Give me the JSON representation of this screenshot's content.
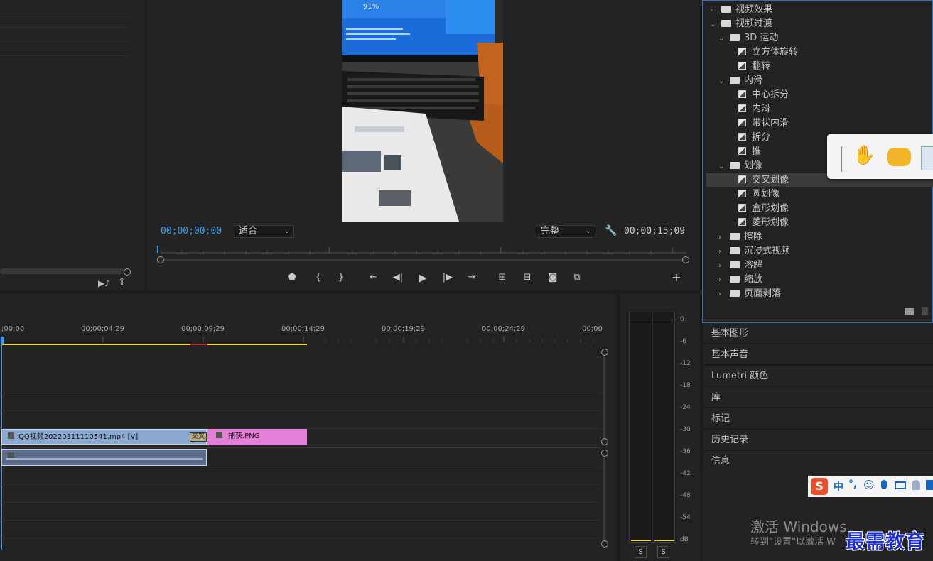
{
  "program_monitor": {
    "timecode_current": "00;00;00;00",
    "timecode_duration": "00;00;15;09",
    "fit_dropdown": "适合",
    "quality_dropdown": "完整",
    "video_progress_text": "91%"
  },
  "effects_tree": [
    {
      "label": "视频效果",
      "type": "folder",
      "expanded": false,
      "level": 0
    },
    {
      "label": "视频过渡",
      "type": "folder",
      "expanded": true,
      "level": 0
    },
    {
      "label": "3D 运动",
      "type": "folder",
      "expanded": true,
      "level": 1
    },
    {
      "label": "立方体旋转",
      "type": "effect",
      "level": 2
    },
    {
      "label": "翻转",
      "type": "effect",
      "level": 2
    },
    {
      "label": "内滑",
      "type": "folder",
      "expanded": true,
      "level": 1
    },
    {
      "label": "中心拆分",
      "type": "effect",
      "level": 2
    },
    {
      "label": "内滑",
      "type": "effect",
      "level": 2
    },
    {
      "label": "带状内滑",
      "type": "effect",
      "level": 2
    },
    {
      "label": "拆分",
      "type": "effect",
      "level": 2
    },
    {
      "label": "推",
      "type": "effect",
      "level": 2
    },
    {
      "label": "划像",
      "type": "folder",
      "expanded": true,
      "level": 1
    },
    {
      "label": "交叉划像",
      "type": "effect",
      "level": 2,
      "selected": true
    },
    {
      "label": "圆划像",
      "type": "effect",
      "level": 2
    },
    {
      "label": "盒形划像",
      "type": "effect",
      "level": 2
    },
    {
      "label": "菱形划像",
      "type": "effect",
      "level": 2
    },
    {
      "label": "擦除",
      "type": "folder",
      "expanded": false,
      "level": 1
    },
    {
      "label": "沉浸式视频",
      "type": "folder",
      "expanded": false,
      "level": 1
    },
    {
      "label": "溶解",
      "type": "folder",
      "expanded": false,
      "level": 1
    },
    {
      "label": "缩放",
      "type": "folder",
      "expanded": false,
      "level": 1
    },
    {
      "label": "页面剥落",
      "type": "folder",
      "expanded": false,
      "level": 1
    }
  ],
  "side_panels": [
    "基本图形",
    "基本声音",
    "Lumetri 颜色",
    "库",
    "标记",
    "历史记录",
    "信息"
  ],
  "timeline": {
    "ruler_labels": [
      ";00;00",
      "00;00;04;29",
      "00;00;09;29",
      "00;00;14;29",
      "00;00;19;29",
      "00;00;24;29",
      "00;00"
    ],
    "clip_video": "QQ视频20220311110541.mp4 [V]",
    "clip_transition": "交叉",
    "clip_image": "捕获.PNG"
  },
  "audio_meter": {
    "db_labels": [
      "0",
      "-6",
      "-12",
      "-18",
      "-24",
      "-30",
      "-36",
      "-42",
      "-48",
      "-54",
      "dB"
    ],
    "solo_labels": [
      "S",
      "S"
    ]
  },
  "ime": {
    "label": "中"
  },
  "watermark": {
    "activate_title": "激活 Windows",
    "activate_sub": "转到\"设置\"以激活 W",
    "brand": "最需教育"
  },
  "colors": {
    "accent_blue": "#2e8fe6",
    "clip_video": "#8aa8d0",
    "clip_image": "#e480d8",
    "work_area": "#e8d62a"
  }
}
